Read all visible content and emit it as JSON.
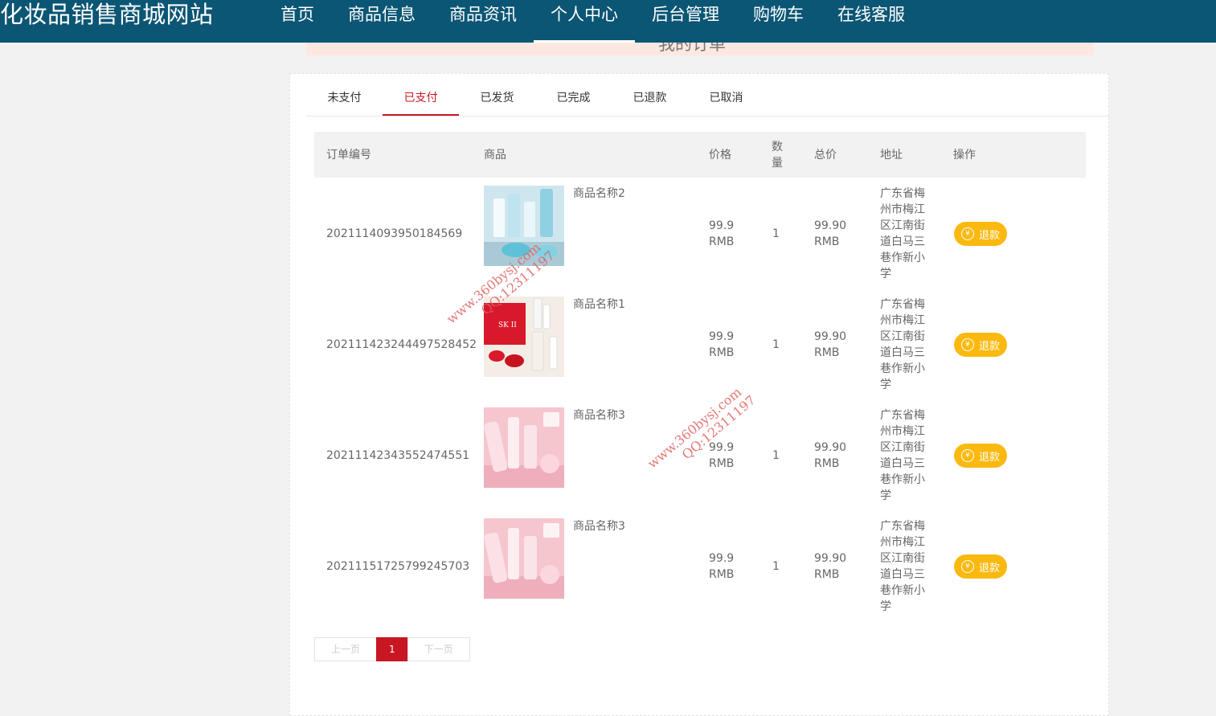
{
  "site": {
    "title": "化妆品销售商城网站"
  },
  "nav": {
    "items": [
      {
        "label": "首页",
        "active": false
      },
      {
        "label": "商品信息",
        "active": false
      },
      {
        "label": "商品资讯",
        "active": false
      },
      {
        "label": "个人中心",
        "active": true
      },
      {
        "label": "后台管理",
        "active": false
      },
      {
        "label": "购物车",
        "active": false
      },
      {
        "label": "在线客服",
        "active": false
      }
    ]
  },
  "page_heading": "我的订单",
  "tabs": [
    {
      "label": "未支付",
      "active": false
    },
    {
      "label": "已支付",
      "active": true
    },
    {
      "label": "已发货",
      "active": false
    },
    {
      "label": "已完成",
      "active": false
    },
    {
      "label": "已退款",
      "active": false
    },
    {
      "label": "已取消",
      "active": false
    }
  ],
  "table": {
    "headers": {
      "order_no": "订单编号",
      "product": "商品",
      "price": "价格",
      "qty_line1": "数",
      "qty_line2": "量",
      "total": "总价",
      "address": "地址",
      "action": "操作"
    },
    "rows": [
      {
        "order_no": "2021114093950184569",
        "product": "商品名称2",
        "price": "99.9",
        "price_unit": "RMB",
        "qty": "1",
        "total": "99.90",
        "total_unit": "RMB",
        "address": [
          "广东省梅",
          "州市梅江",
          "区江南街",
          "道白马三",
          "巷作新小",
          "学"
        ],
        "action": "退款",
        "image": "blue-skincare"
      },
      {
        "order_no": "20211142324449752845​2",
        "product": "商品名称1",
        "price": "99.9",
        "price_unit": "RMB",
        "qty": "1",
        "total": "99.90",
        "total_unit": "RMB",
        "address": [
          "广东省梅",
          "州市梅江",
          "区江南街",
          "道白马三",
          "巷作新小",
          "学"
        ],
        "action": "退款",
        "image": "skii-set"
      },
      {
        "order_no": "2021114234355247455​1",
        "product": "商品名称3",
        "price": "99.9",
        "price_unit": "RMB",
        "qty": "1",
        "total": "99.90",
        "total_unit": "RMB",
        "address": [
          "广东省梅",
          "州市梅江",
          "区江南街",
          "道白马三",
          "巷作新小",
          "学"
        ],
        "action": "退款",
        "image": "pink-skincare"
      },
      {
        "order_no": "2021115172579924570​3",
        "product": "商品名称3",
        "price": "99.9",
        "price_unit": "RMB",
        "qty": "1",
        "total": "99.90",
        "total_unit": "RMB",
        "address": [
          "广东省梅",
          "州市梅江",
          "区江南街",
          "道白马三",
          "巷作新小",
          "学"
        ],
        "action": "退款",
        "image": "pink-skincare"
      }
    ]
  },
  "pager": {
    "prev": "上一页",
    "current": "1",
    "next": "下一页"
  },
  "watermarks": [
    {
      "line1": "www.360bysj.com",
      "line2": "QQ:12311197"
    },
    {
      "line1": "www.360bysj.com",
      "line2": "QQ:12311197"
    }
  ],
  "colors": {
    "topbar": "#0b5674",
    "accent": "#c81623",
    "refund_button": "#fbb910"
  }
}
